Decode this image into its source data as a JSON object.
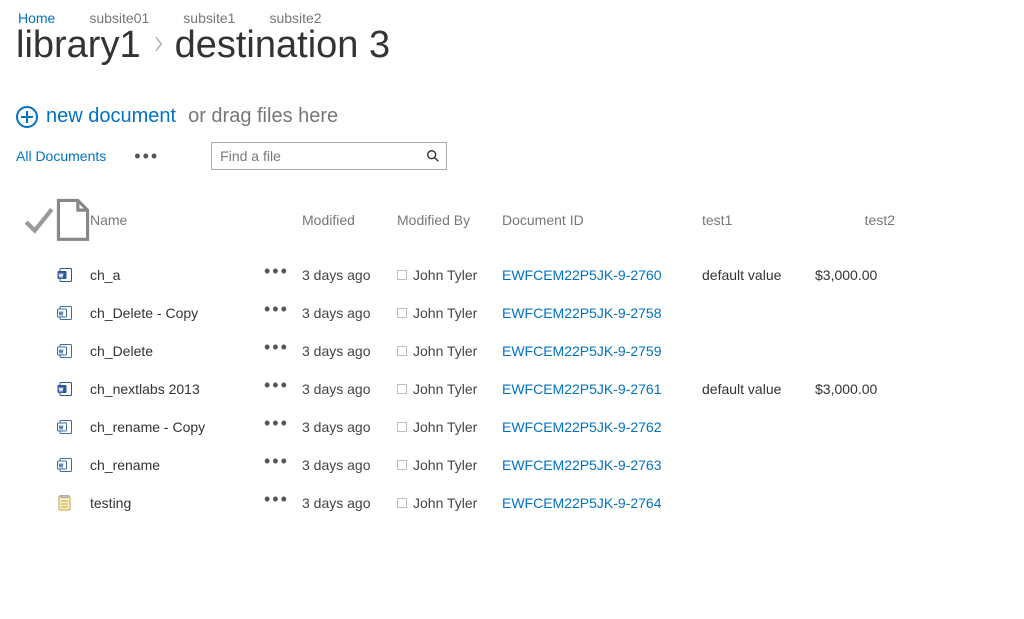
{
  "nav": {
    "items": [
      {
        "label": "Home",
        "active": true
      },
      {
        "label": "subsite01",
        "active": false
      },
      {
        "label": "subsite1",
        "active": false
      },
      {
        "label": "subsite2",
        "active": false
      }
    ]
  },
  "title": {
    "library": "library1",
    "folder": "destination 3"
  },
  "newdoc": {
    "link": "new document",
    "hint": "or drag files here"
  },
  "views": {
    "current": "All Documents"
  },
  "search": {
    "placeholder": "Find a file"
  },
  "table": {
    "headers": {
      "name": "Name",
      "modified": "Modified",
      "modified_by": "Modified By",
      "doc_id": "Document ID",
      "test1": "test1",
      "test2": "test2"
    },
    "rows": [
      {
        "icon": "docx",
        "name": "ch_a",
        "modified": "3 days ago",
        "by": "John Tyler",
        "docid": "EWFCEM22P5JK-9-2760",
        "t1": "default value",
        "t2": "$3,000.00"
      },
      {
        "icon": "doc",
        "name": "ch_Delete - Copy",
        "modified": "3 days ago",
        "by": "John Tyler",
        "docid": "EWFCEM22P5JK-9-2758",
        "t1": "",
        "t2": ""
      },
      {
        "icon": "doc",
        "name": "ch_Delete",
        "modified": "3 days ago",
        "by": "John Tyler",
        "docid": "EWFCEM22P5JK-9-2759",
        "t1": "",
        "t2": ""
      },
      {
        "icon": "docx",
        "name": "ch_nextlabs 2013",
        "modified": "3 days ago",
        "by": "John Tyler",
        "docid": "EWFCEM22P5JK-9-2761",
        "t1": "default value",
        "t2": "$3,000.00"
      },
      {
        "icon": "doc",
        "name": "ch_rename - Copy",
        "modified": "3 days ago",
        "by": "John Tyler",
        "docid": "EWFCEM22P5JK-9-2762",
        "t1": "",
        "t2": ""
      },
      {
        "icon": "doc",
        "name": "ch_rename",
        "modified": "3 days ago",
        "by": "John Tyler",
        "docid": "EWFCEM22P5JK-9-2763",
        "t1": "",
        "t2": ""
      },
      {
        "icon": "note",
        "name": "testing",
        "modified": "3 days ago",
        "by": "John Tyler",
        "docid": "EWFCEM22P5JK-9-2764",
        "t1": "",
        "t2": ""
      }
    ]
  }
}
